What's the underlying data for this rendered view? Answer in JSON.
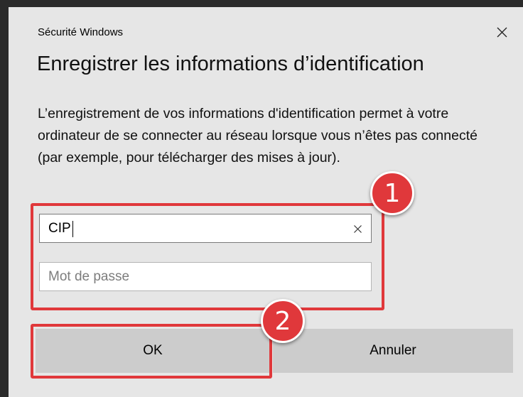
{
  "window": {
    "title": "Sécurité Windows",
    "close_icon": "close-icon"
  },
  "dialog": {
    "heading": "Enregistrer les informations d’identification",
    "message": "L’enregistrement de vos informations d'identification permet à votre ordinateur de se connecter au réseau lorsque vous n’êtes pas connecté (par exemple, pour télécharger des mises à jour)."
  },
  "form": {
    "username": {
      "value": "CIP",
      "placeholder": "",
      "clear_icon": "clear-icon"
    },
    "password": {
      "value": "",
      "placeholder": "Mot de passe"
    }
  },
  "buttons": {
    "ok": "OK",
    "cancel": "Annuler"
  },
  "annotations": {
    "badge_1": "1",
    "badge_2": "2",
    "color": "#e0383b"
  }
}
